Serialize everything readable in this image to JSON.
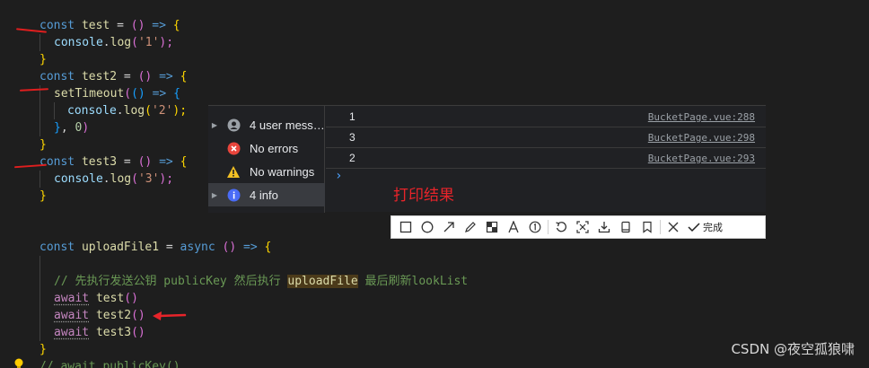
{
  "editor": {
    "lines": {
      "l1": {
        "kw": "const",
        "name": "test",
        "eq": " = ",
        "open": "()",
        "arrow": " => ",
        "brace": "{"
      },
      "l2": {
        "obj": "console",
        "dot": ".",
        "fn": "log",
        "open": "(",
        "str": "'1'",
        "close": ");"
      },
      "l3": {
        "brace": "}"
      },
      "l4": {
        "kw": "const",
        "name": "test2",
        "eq": " = ",
        "open": "()",
        "arrow": " => ",
        "brace": "{"
      },
      "l5": {
        "fn": "setTimeout",
        "open": "(",
        "inner": "()",
        "arrow": " => ",
        "brace": "{"
      },
      "l6": {
        "obj": "console",
        "dot": ".",
        "fn": "log",
        "open": "(",
        "str": "'2'",
        "close": ");"
      },
      "l7": {
        "brace": "}",
        "comma": ", ",
        "num": "0",
        "close": ")"
      },
      "l8": {
        "brace": "}"
      },
      "l9": {
        "kw": "const",
        "name": "test3",
        "eq": " = ",
        "open": "()",
        "arrow": " => ",
        "brace": "{"
      },
      "l10": {
        "obj": "console",
        "dot": ".",
        "fn": "log",
        "open": "(",
        "str": "'3'",
        "close": ");"
      },
      "l11": {
        "brace": "}"
      },
      "l12": {
        "kw": "const",
        "name": "uploadFile1",
        "eq": " = ",
        "async": "async",
        "open": " ()",
        "arrow": " => ",
        "brace": "{"
      },
      "l13": {
        "comment_a": "// 先执行发送公钥 publicKey 然后执行 ",
        "comment_hl": "uploadFile",
        "comment_b": " 最后刷新lookList"
      },
      "l14": {
        "aw": "await",
        "call": " test",
        "paren": "()"
      },
      "l15": {
        "aw": "await",
        "call": " test2",
        "paren": "()"
      },
      "l16": {
        "aw": "await",
        "call": " test3",
        "paren": "()"
      },
      "l17": {
        "brace": "}"
      },
      "l18": {
        "text": "// await publicKey()"
      }
    }
  },
  "console": {
    "sidebar": [
      {
        "label": "4 user mess…",
        "icon": "user-icon"
      },
      {
        "label": "No errors",
        "icon": "error-icon"
      },
      {
        "label": "No warnings",
        "icon": "warning-icon"
      },
      {
        "label": "4 info",
        "icon": "info-icon"
      }
    ],
    "logs": [
      {
        "value": "1",
        "source": "BucketPage.vue:288"
      },
      {
        "value": "3",
        "source": "BucketPage.vue:298"
      },
      {
        "value": "2",
        "source": "BucketPage.vue:293"
      }
    ],
    "prompt": "›"
  },
  "annotation": "打印结果",
  "toolbar": {
    "tools": [
      "rectangle-icon",
      "ellipse-icon",
      "arrow-icon",
      "pen-icon",
      "mosaic-icon",
      "text-icon",
      "number-icon",
      "undo-icon",
      "ocr-icon",
      "download-icon",
      "pin-icon",
      "bookmark-icon",
      "cancel-icon",
      "confirm-icon"
    ],
    "confirm_label": "完成"
  },
  "watermark": "CSDN @夜空孤狼啸",
  "colors": {
    "editor_bg": "#1e1e1e",
    "console_bg": "#202124",
    "annotation_red": "#e8242a",
    "keyword": "#569cd6",
    "string": "#ce9178"
  }
}
